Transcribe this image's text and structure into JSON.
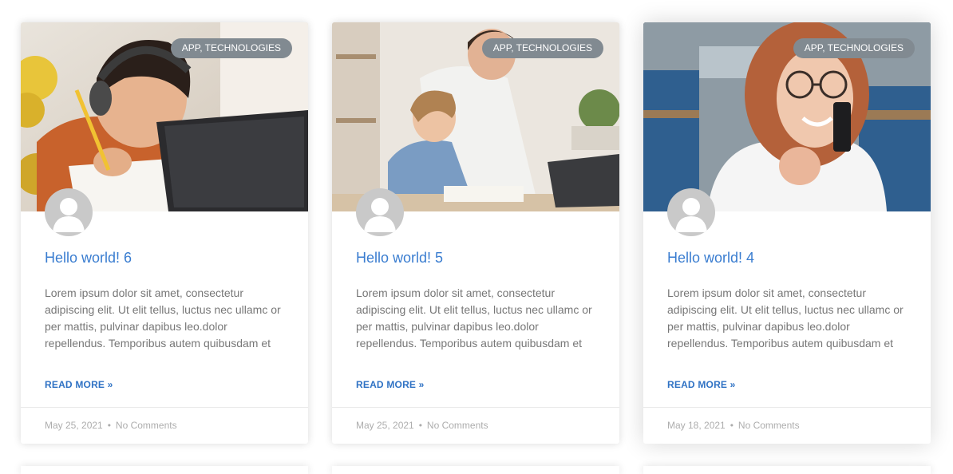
{
  "posts": [
    {
      "badge": "APP, TECHNOLOGIES",
      "title": "Hello world! 6",
      "excerpt": "Lorem ipsum dolor sit amet, consectetur adipiscing elit. Ut elit tellus, luctus nec ullamc or per mattis, pulvinar dapibus leo.dolor repellendus. Temporibus autem quibusdam et",
      "read_more": "READ MORE »",
      "date": "May 25, 2021",
      "separator": "•",
      "comments": "No Comments"
    },
    {
      "badge": "APP, TECHNOLOGIES",
      "title": "Hello world! 5",
      "excerpt": "Lorem ipsum dolor sit amet, consectetur adipiscing elit. Ut elit tellus, luctus nec ullamc or per mattis, pulvinar dapibus leo.dolor repellendus. Temporibus autem quibusdam et",
      "read_more": "READ MORE »",
      "date": "May 25, 2021",
      "separator": "•",
      "comments": "No Comments"
    },
    {
      "badge": "APP, TECHNOLOGIES",
      "title": "Hello world! 4",
      "excerpt": "Lorem ipsum dolor sit amet, consectetur adipiscing elit. Ut elit tellus, luctus nec ullamc or per mattis, pulvinar dapibus leo.dolor repellendus. Temporibus autem quibusdam et",
      "read_more": "READ MORE »",
      "date": "May 18, 2021",
      "separator": "•",
      "comments": "No Comments"
    }
  ],
  "colors": {
    "title": "#3a7dd0",
    "read_more": "#2f72c4",
    "badge_bg": "#818a91",
    "meta_text": "#adadad",
    "excerpt": "#777777"
  },
  "icons": {
    "avatar": "default-user-avatar-icon"
  }
}
